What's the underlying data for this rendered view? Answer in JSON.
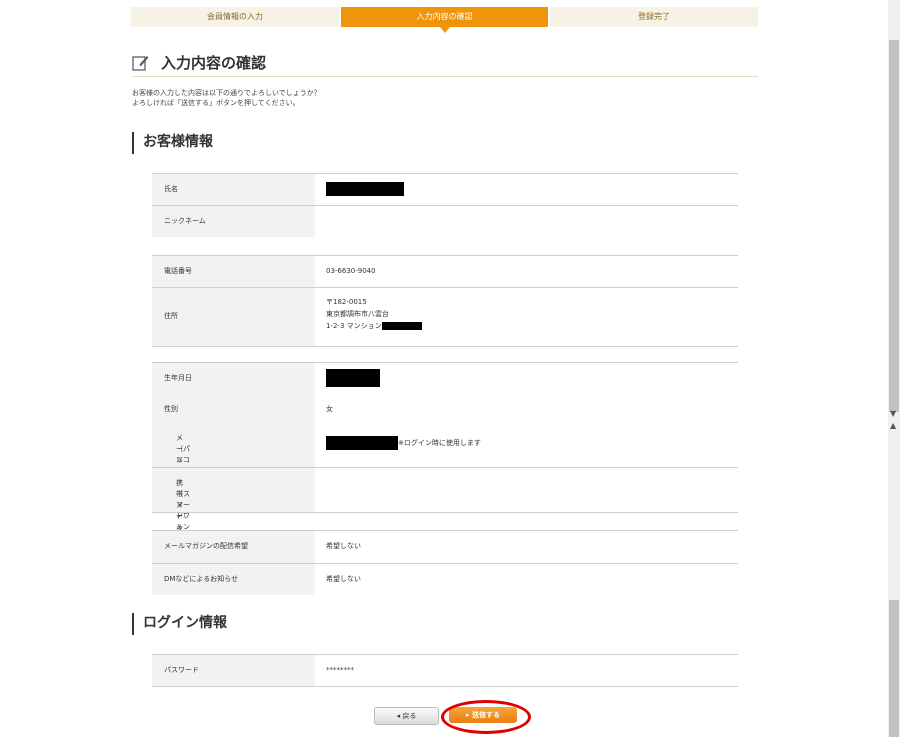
{
  "steps": {
    "step1": "会員情報の入力",
    "step2": "入力内容の確認",
    "step3": "登録完了"
  },
  "page_title": "入力内容の確認",
  "intro": {
    "line1": "お客様の入力した内容は以下の通りでよろしいでしょうか？",
    "line2": "よろしければ「送信する」ボタンを押してください。"
  },
  "customer_section": {
    "title": "お客様情報",
    "name_label": "氏名",
    "nickname_label": "ニックネーム",
    "phone_label": "電話番号",
    "phone_value": "03-6630-9040",
    "address_label": "住所",
    "address_line1": "〒182-0015",
    "address_line2": "東京都調布市八雲台",
    "address_line3": "1-2-3 マンション",
    "birthday_label": "生年月日",
    "gender_label": "性別",
    "gender_value": "女",
    "email_label1": "メールアドレス",
    "email_label2": "（パソコン・スマートフォン）",
    "email_note": "※ログイン時に使用します",
    "mobile_email_label1": "携帯メールアドレス",
    "mobile_email_label2": "（スマートフォン以外）",
    "newsletter_label": "メールマガジンの配信希望",
    "newsletter_value": "希望しない",
    "dm_label": "DMなどによるお知らせ",
    "dm_value": "希望しない"
  },
  "login_section": {
    "title": "ログイン情報",
    "password_label": "パスワード",
    "password_value": "********"
  },
  "buttons": {
    "back": "◂ 戻る",
    "send": "▸ 送信する"
  },
  "colors": {
    "accent": "#f0940c",
    "highlight": "#e00000"
  }
}
